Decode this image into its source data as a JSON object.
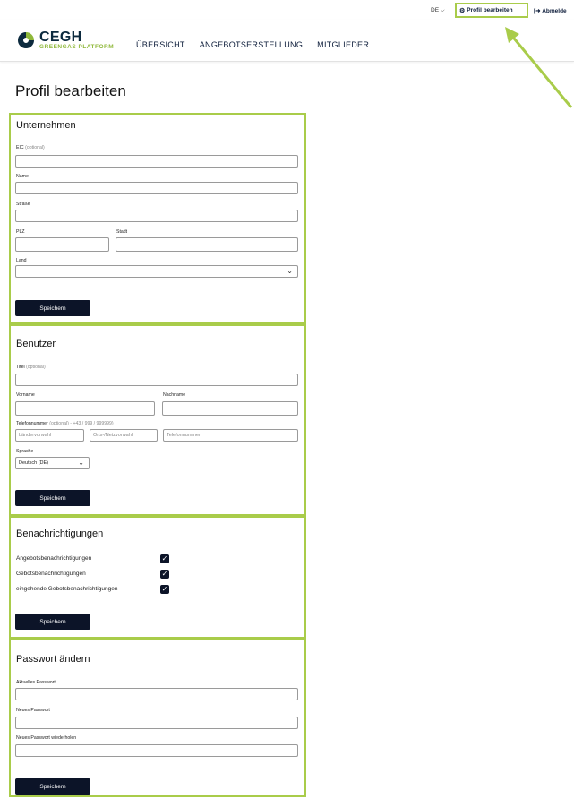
{
  "topbar": {
    "language": "DE",
    "profile_link": "Profil bearbeiten",
    "logout_link": "Abmelde"
  },
  "logo": {
    "name": "CEGH",
    "sub": "GREENGAS PLATFORM"
  },
  "nav": [
    "ÜBERSICHT",
    "ANGEBOTSERSTELLUNG",
    "MITGLIEDER"
  ],
  "page_title": "Profil bearbeiten",
  "company": {
    "title": "Unternehmen",
    "eic_label": "EIC",
    "eic_optional": "(optional)",
    "name_label": "Name",
    "street_label": "Straße",
    "zip_label": "PLZ",
    "city_label": "Stadt",
    "country_label": "Land",
    "save": "Speichern"
  },
  "user": {
    "title": "Benutzer",
    "title_label": "Titel",
    "title_optional": "(optional)",
    "firstname_label": "Vorname",
    "lastname_label": "Nachname",
    "phone_label": "Telefonnummer",
    "phone_hint": "(optional) - +43 / 999 / 999999)",
    "country_code_placeholder": "Ländervorwahl",
    "area_code_placeholder": "Orts-/Netzvorwahl",
    "number_placeholder": "Telefonnummer",
    "language_label": "Sprache",
    "language_value": "Deutsch (DE)",
    "save": "Speichern"
  },
  "notifications": {
    "title": "Benachrichtigungen",
    "items": [
      {
        "label": "Angebotsbenachrichtigungen",
        "checked": true
      },
      {
        "label": "Gebotsbenachrichtigungen",
        "checked": true
      },
      {
        "label": "eingehende Gebotsbenachrichtigungen",
        "checked": true
      }
    ],
    "save": "Speichern"
  },
  "password": {
    "title": "Passwort ändern",
    "current_label": "Aktuelles Passwort",
    "new_label": "Neues Passwort",
    "repeat_label": "Neues Passwort wiederholen",
    "save": "Speichern"
  },
  "colors": {
    "highlight": "#a9cc4a",
    "primary": "#0c1428",
    "brand_green": "#8fb83a"
  }
}
